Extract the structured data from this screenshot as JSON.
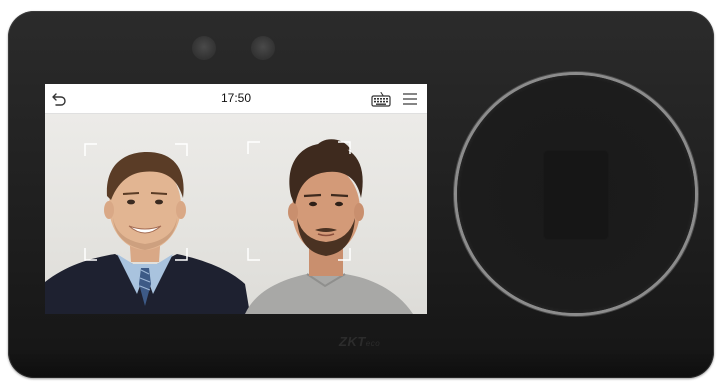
{
  "screen": {
    "status_bar": {
      "time": "17:50",
      "icons": {
        "back": "back-arrow-icon",
        "keyboard": "keyboard-icon",
        "menu": "hamburger-menu-icon"
      }
    },
    "camera_view": {
      "detected_faces": 2
    }
  },
  "device": {
    "logo_text": "ZKT",
    "logo_suffix": "eco"
  },
  "colors": {
    "device_body": "#232323",
    "screen_bar": "#ffffff",
    "face_frame": "#ffffff",
    "sensor_ring": "#8c8c8c"
  }
}
